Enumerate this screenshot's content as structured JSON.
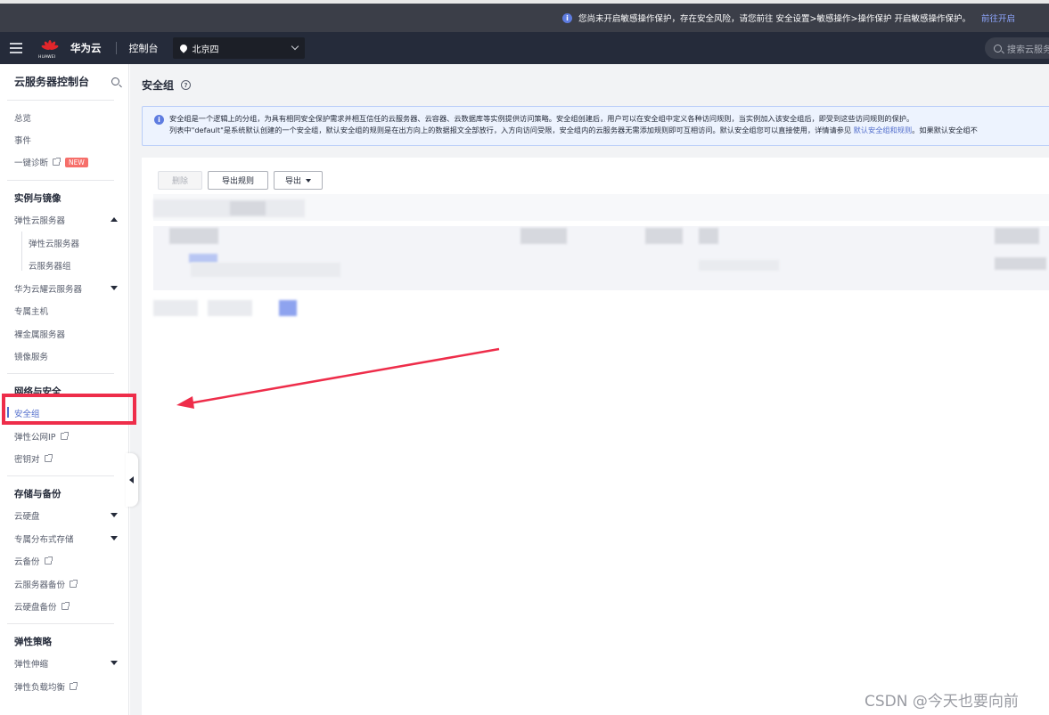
{
  "notice": {
    "text": "您尚未开启敏感操作保护，存在安全风险，请您前往 安全设置>敏感操作>操作保护 开启敏感操作保护。",
    "link": "前往开启"
  },
  "topnav": {
    "brand": "华为云",
    "logo_text": "HUAWEI",
    "console": "控制台",
    "region": "北京四",
    "search_placeholder": "搜索云服务"
  },
  "sidebar": {
    "title": "云服务器控制台",
    "items": {
      "overview": "总览",
      "events": "事件",
      "diagnose": "一键诊断",
      "new_badge": "NEW"
    },
    "groups": {
      "instances": "实例与镜像",
      "network": "网络与安全",
      "storage": "存储与备份",
      "policy": "弹性策略"
    },
    "instances": {
      "ecs": "弹性云服务器",
      "ecs_sub1": "弹性云服务器",
      "ecs_sub2": "云服务器组",
      "flexus": "华为云耀云服务器",
      "dedicated_host": "专属主机",
      "bms": "裸金属服务器",
      "image": "镜像服务"
    },
    "network": {
      "security_group": "安全组",
      "eip": "弹性公网IP",
      "keypair": "密钥对"
    },
    "storage": {
      "evs": "云硬盘",
      "dss": "专属分布式存储",
      "cbr": "云备份",
      "ecs_backup": "云服务器备份",
      "evs_backup": "云硬盘备份"
    },
    "policy": {
      "as": "弹性伸缩",
      "elb": "弹性负载均衡"
    }
  },
  "page": {
    "title": "安全组",
    "alert_line1": "安全组是一个逻辑上的分组，为具有相同安全保护需求并相互信任的云服务器、云容器、云数据库等实例提供访问策略。安全组创建后，用户可以在安全组中定义各种访问规则，当实例加入该安全组后，即受到这些访问规则的保护。",
    "alert_line2_prefix": "列表中\"default\"是系统默认创建的一个安全组，默认安全组的规则是在出方向上的数据报文全部放行，入方向访问受限，安全组内的云服务器无需添加规则即可互相访问。默认安全组您可以直接使用，详情请参见 ",
    "alert_link": "默认安全组和规则",
    "alert_line2_suffix": "。如果默认安全组不",
    "buttons": {
      "delete": "删除",
      "export_rules": "导出规则",
      "export": "导出"
    }
  },
  "watermark": "CSDN @今天也要向前",
  "colors": {
    "topbar": "#252b3a",
    "accent": "#526ecc",
    "highlight": "#ee2d4a",
    "brand_red": "#e1262b"
  }
}
